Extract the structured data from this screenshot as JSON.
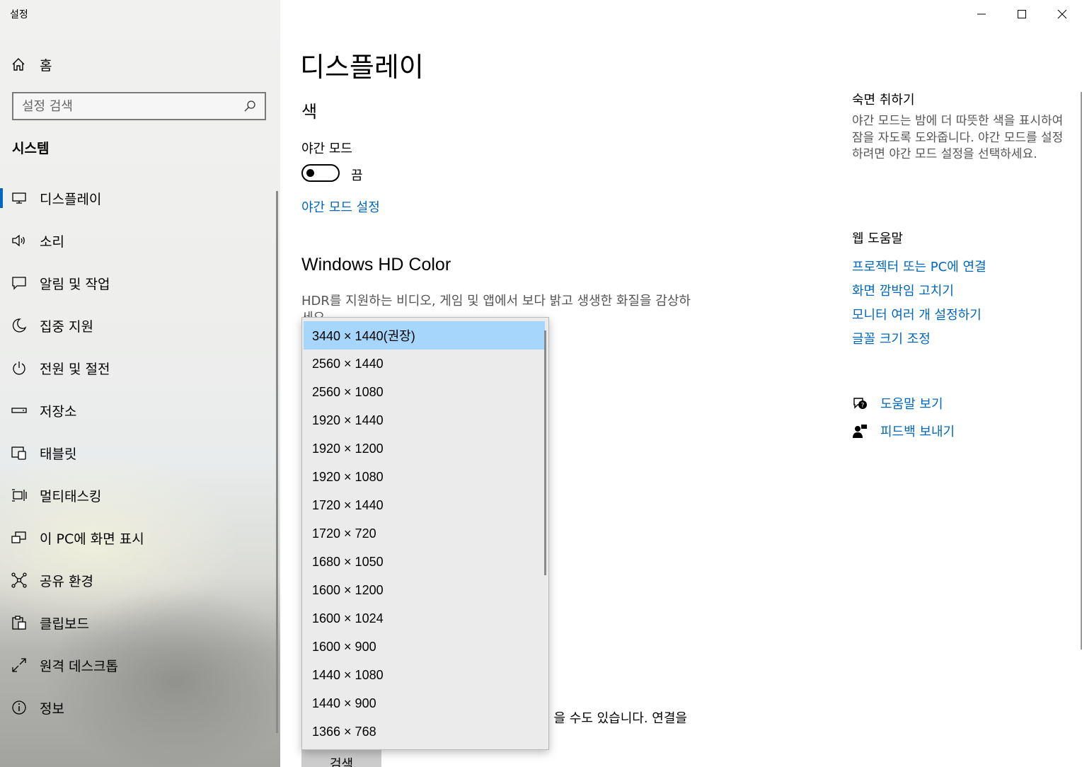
{
  "window": {
    "title": "설정"
  },
  "sidebar": {
    "home_label": "홈",
    "search_placeholder": "설정 검색",
    "section_title": "시스템",
    "items": [
      {
        "label": "디스플레이",
        "icon": "monitor-icon"
      },
      {
        "label": "소리",
        "icon": "speaker-icon"
      },
      {
        "label": "알림 및 작업",
        "icon": "notification-icon"
      },
      {
        "label": "집중 지원",
        "icon": "moon-icon"
      },
      {
        "label": "전원 및 절전",
        "icon": "power-icon"
      },
      {
        "label": "저장소",
        "icon": "storage-icon"
      },
      {
        "label": "태블릿",
        "icon": "tablet-icon"
      },
      {
        "label": "멀티태스킹",
        "icon": "multitasking-icon"
      },
      {
        "label": "이 PC에 화면 표시",
        "icon": "project-icon"
      },
      {
        "label": "공유 환경",
        "icon": "share-icon"
      },
      {
        "label": "클립보드",
        "icon": "clipboard-icon"
      },
      {
        "label": "원격 데스크톱",
        "icon": "remote-desktop-icon"
      },
      {
        "label": "정보",
        "icon": "info-icon"
      }
    ]
  },
  "main": {
    "page_title": "디스플레이",
    "color_heading": "색",
    "night_mode_label": "야간 모드",
    "night_mode_state": "끔",
    "night_mode_link": "야간 모드 설정",
    "hdr_heading": "Windows HD Color",
    "hdr_desc": "HDR를 지원하는 비디오, 게임 및 앱에서 보다 밝고 생생한 화질을 감상하세요.",
    "partial_text": "을 수도 있습니다. 연결을",
    "bottom_button": "검색"
  },
  "right": {
    "sleep_title": "숙면 취하기",
    "sleep_desc": "야간 모드는 밤에 더 따뜻한 색을 표시하여 잠을 자도록 도와줍니다. 야간 모드를 설정하려면 야간 모드 설정을 선택하세요.",
    "web_help_title": "웹 도움말",
    "links": [
      "프로젝터 또는 PC에 연결",
      "화면 깜박임 고치기",
      "모니터 여러 개 설정하기",
      "글꼴 크기 조정"
    ],
    "help_link": "도움말 보기",
    "feedback_link": "피드백 보내기"
  },
  "dropdown": {
    "selected_index": 0,
    "options": [
      "3440 × 1440(권장)",
      "2560 × 1440",
      "2560 × 1080",
      "1920 × 1440",
      "1920 × 1200",
      "1920 × 1080",
      "1720 × 1440",
      "1720 × 720",
      "1680 × 1050",
      "1600 × 1200",
      "1600 × 1024",
      "1600 × 900",
      "1440 × 1080",
      "1440 × 900",
      "1366 × 768"
    ]
  },
  "colors": {
    "accent": "#0067c0",
    "selection": "#a6d6fc"
  }
}
